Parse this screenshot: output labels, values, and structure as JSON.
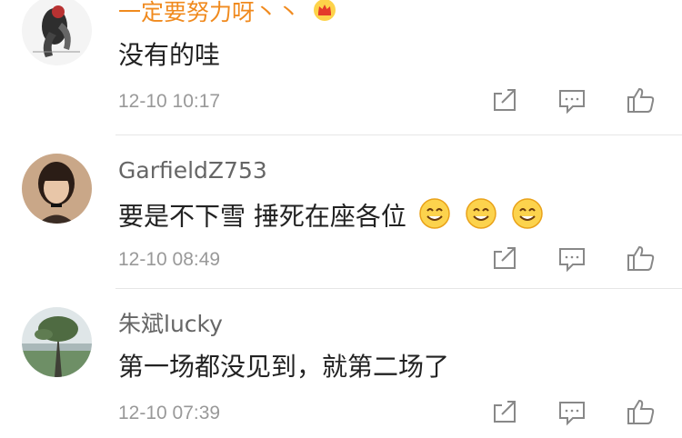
{
  "comments": [
    {
      "username": "一定要努力呀丶丶",
      "username_color": "#f08a1e",
      "text": "没有的哇",
      "time": "12-10 10:17",
      "badge_icon": "crown-icon"
    },
    {
      "username": "GarfieldZ753",
      "username_color": "#666666",
      "text": "要是不下雪 捶死在座各位",
      "time": "12-10 08:49",
      "emoji_icons": [
        "smile-emoji-icon",
        "smile-emoji-icon",
        "smile-emoji-icon"
      ]
    },
    {
      "username": "朱斌lucky",
      "username_color": "#666666",
      "text": "第一场都没见到，就第二场了",
      "time": "12-10 07:39"
    }
  ],
  "actions": [
    "share-icon",
    "comment-icon",
    "like-icon"
  ]
}
